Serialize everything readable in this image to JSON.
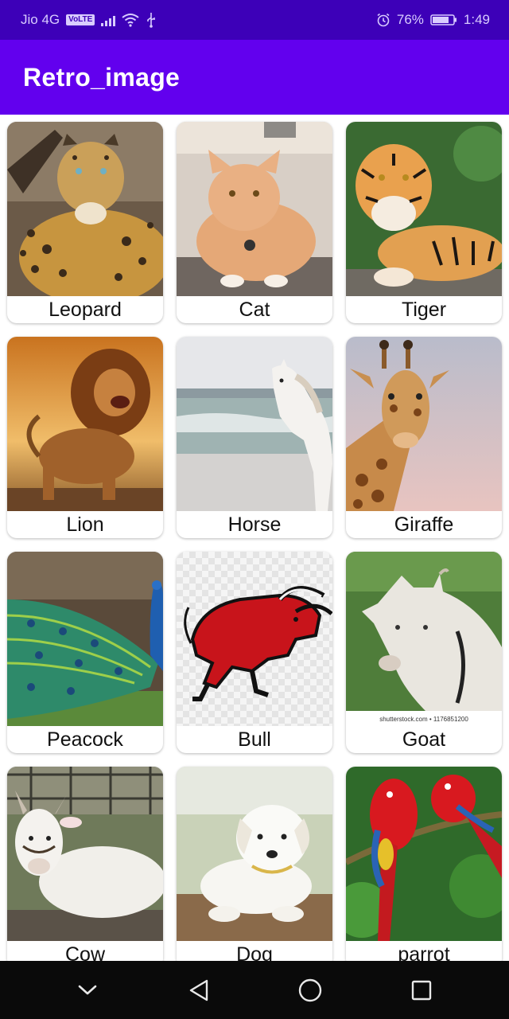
{
  "status": {
    "carrier": "Jio 4G",
    "volte": "VoLTE",
    "battery": "76%",
    "time": "1:49"
  },
  "app": {
    "title": "Retro_image"
  },
  "animals": [
    {
      "label": "Leopard",
      "icon": "leopard-image"
    },
    {
      "label": "Cat",
      "icon": "cat-image"
    },
    {
      "label": "Tiger",
      "icon": "tiger-image"
    },
    {
      "label": "Lion",
      "icon": "lion-image"
    },
    {
      "label": "Horse",
      "icon": "horse-image"
    },
    {
      "label": "Giraffe",
      "icon": "giraffe-image"
    },
    {
      "label": "Peacock",
      "icon": "peacock-image"
    },
    {
      "label": "Bull",
      "icon": "bull-image"
    },
    {
      "label": "Goat",
      "icon": "goat-image",
      "watermark": "shutterstock.com • 1176851200"
    },
    {
      "label": "Cow",
      "icon": "cow-image"
    },
    {
      "label": "Dog",
      "icon": "dog-image"
    },
    {
      "label": "parrot",
      "icon": "parrot-image"
    }
  ],
  "nav": [
    "collapse-icon",
    "back-icon",
    "home-icon",
    "recents-icon"
  ]
}
